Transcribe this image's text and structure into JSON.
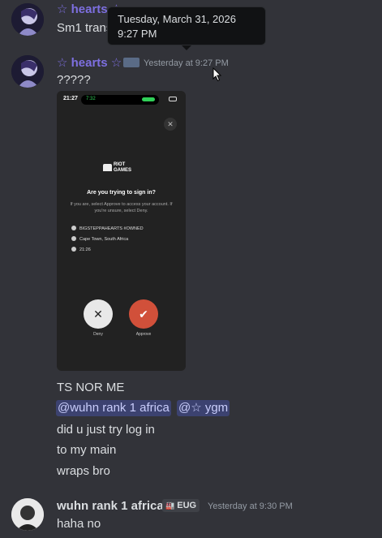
{
  "messages": [
    {
      "author": "☆ hearts ☆",
      "author_color": "#7d6fe0",
      "text": "Sm1 trans"
    },
    {
      "author": "☆ hearts ☆",
      "author_color": "#7d6fe0",
      "timestamp": "Yesterday at 9:27 PM",
      "text": "?????"
    }
  ],
  "tooltip": {
    "text": "Tuesday, March 31, 2026 9:27 PM"
  },
  "attachment": {
    "status_time": "21:27",
    "call_time": "7:32",
    "logo_line1": "RIOT",
    "logo_line2": "GAMES",
    "title": "Are you trying to sign in?",
    "description": "If you are, select Approve to access your account. If you're unsure, select Deny.",
    "account": "BIGSTEPPAHEARTS #OWNED",
    "location": "Cape Town, South Africa",
    "time": "21:26",
    "deny_label": "Deny",
    "approve_label": "Approve",
    "close_glyph": "✕",
    "deny_glyph": "✕",
    "approve_glyph": "✔"
  },
  "followups": {
    "line1": "TS NOR ME",
    "mention1": "@wuhn rank 1 africa",
    "mention2": "@☆ ygm",
    "line2": "did u just try log in",
    "line3": "to my main",
    "line4": "wraps bro"
  },
  "reply": {
    "author": "wuhn rank 1 africa",
    "author_color": "#dbdee1",
    "tag_icon": "🏭",
    "tag": "EUG",
    "timestamp": "Yesterday at 9:30 PM",
    "text": "haha no"
  },
  "colors": {
    "background": "#323339",
    "mention_bg": "#3c4270",
    "hearts_name": "#7d6fe0"
  },
  "icons": {
    "cursor": "mouse-pointer-icon",
    "account": "user-icon",
    "location": "location-pin-icon",
    "clock": "clock-icon"
  }
}
